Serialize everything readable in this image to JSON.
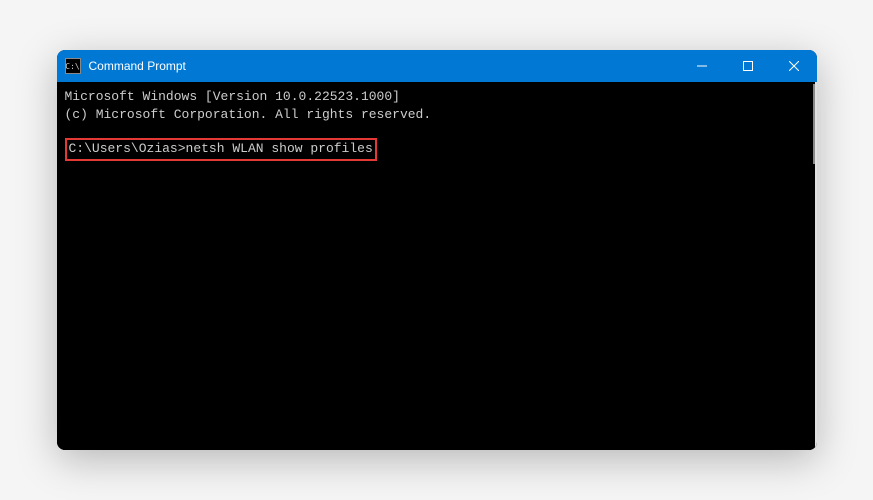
{
  "window": {
    "title": "Command Prompt",
    "icon_text": "C:\\"
  },
  "terminal": {
    "lines": [
      "Microsoft Windows [Version 10.0.22523.1000]",
      "(c) Microsoft Corporation. All rights reserved."
    ],
    "prompt": "C:\\Users\\Ozias>",
    "command": "netsh WLAN show profiles"
  }
}
